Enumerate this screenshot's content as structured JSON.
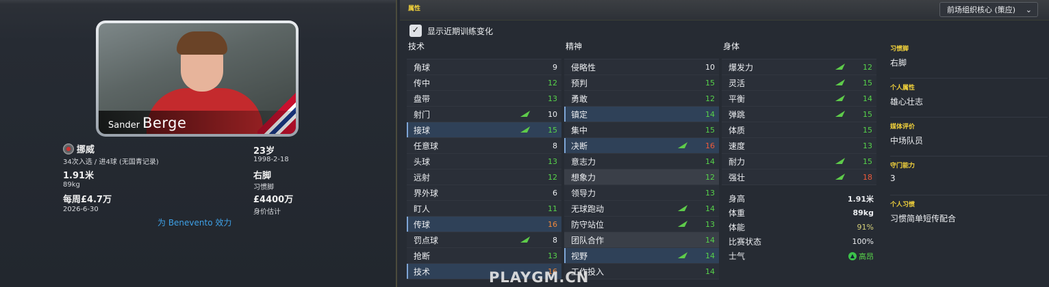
{
  "player": {
    "first_name": "Sander",
    "last_name": "Berge",
    "nation": "挪威",
    "caps": "34次入选 / 进4球 (无国青记录)",
    "age": "23岁",
    "dob": "1998-2-18",
    "height": "1.91米",
    "weight": "89kg",
    "foot": "右脚",
    "foot_label": "习惯脚",
    "wage": "每周£4.7万",
    "contract_end": "2026-6-30",
    "value": "£4400万",
    "value_label": "身价估计",
    "club_line": "为 Benevento 效力"
  },
  "attributes": {
    "section_title": "属性",
    "role": "前场组织核心 (策应)",
    "show_training_label": "显示近期训练变化",
    "show_training_checked": true,
    "technical": {
      "title": "技术",
      "rows": [
        {
          "name": "角球",
          "value": "9",
          "color": "white",
          "arrow": false,
          "hl": ""
        },
        {
          "name": "传中",
          "value": "12",
          "color": "green",
          "arrow": false,
          "hl": ""
        },
        {
          "name": "盘带",
          "value": "13",
          "color": "green",
          "arrow": false,
          "hl": ""
        },
        {
          "name": "射门",
          "value": "10",
          "color": "white",
          "arrow": true,
          "hl": ""
        },
        {
          "name": "接球",
          "value": "15",
          "color": "green",
          "arrow": true,
          "hl": "hl"
        },
        {
          "name": "任意球",
          "value": "8",
          "color": "white",
          "arrow": false,
          "hl": ""
        },
        {
          "name": "头球",
          "value": "13",
          "color": "green",
          "arrow": false,
          "hl": ""
        },
        {
          "name": "远射",
          "value": "12",
          "color": "green",
          "arrow": false,
          "hl": ""
        },
        {
          "name": "界外球",
          "value": "6",
          "color": "white",
          "arrow": false,
          "hl": ""
        },
        {
          "name": "盯人",
          "value": "11",
          "color": "green",
          "arrow": false,
          "hl": ""
        },
        {
          "name": "传球",
          "value": "16",
          "color": "orange",
          "arrow": false,
          "hl": "hl"
        },
        {
          "name": "罚点球",
          "value": "8",
          "color": "white",
          "arrow": true,
          "hl": ""
        },
        {
          "name": "抢断",
          "value": "13",
          "color": "green",
          "arrow": false,
          "hl": ""
        },
        {
          "name": "技术",
          "value": "16",
          "color": "orange",
          "arrow": false,
          "hl": "hl"
        }
      ]
    },
    "mental": {
      "title": "精神",
      "rows": [
        {
          "name": "侵略性",
          "value": "10",
          "color": "white",
          "arrow": false,
          "hl": ""
        },
        {
          "name": "预判",
          "value": "15",
          "color": "green",
          "arrow": false,
          "hl": ""
        },
        {
          "name": "勇敢",
          "value": "12",
          "color": "green",
          "arrow": false,
          "hl": ""
        },
        {
          "name": "镇定",
          "value": "14",
          "color": "green",
          "arrow": false,
          "hl": "hl"
        },
        {
          "name": "集中",
          "value": "15",
          "color": "green",
          "arrow": false,
          "hl": ""
        },
        {
          "name": "决断",
          "value": "16",
          "color": "red",
          "arrow": true,
          "hl": "hl"
        },
        {
          "name": "意志力",
          "value": "14",
          "color": "green",
          "arrow": false,
          "hl": ""
        },
        {
          "name": "想象力",
          "value": "12",
          "color": "green",
          "arrow": false,
          "hl": "hl2"
        },
        {
          "name": "领导力",
          "value": "13",
          "color": "green",
          "arrow": false,
          "hl": ""
        },
        {
          "name": "无球跑动",
          "value": "14",
          "color": "green",
          "arrow": true,
          "hl": ""
        },
        {
          "name": "防守站位",
          "value": "13",
          "color": "green",
          "arrow": true,
          "hl": ""
        },
        {
          "name": "团队合作",
          "value": "14",
          "color": "green",
          "arrow": false,
          "hl": "hl2"
        },
        {
          "name": "视野",
          "value": "14",
          "color": "green",
          "arrow": true,
          "hl": "hl"
        },
        {
          "name": "工作投入",
          "value": "14",
          "color": "green",
          "arrow": false,
          "hl": ""
        }
      ]
    },
    "physical": {
      "title": "身体",
      "rows": [
        {
          "name": "爆发力",
          "value": "12",
          "color": "green",
          "arrow": true,
          "hl": ""
        },
        {
          "name": "灵活",
          "value": "15",
          "color": "green",
          "arrow": true,
          "hl": ""
        },
        {
          "name": "平衡",
          "value": "14",
          "color": "green",
          "arrow": true,
          "hl": ""
        },
        {
          "name": "弹跳",
          "value": "15",
          "color": "green",
          "arrow": true,
          "hl": ""
        },
        {
          "name": "体质",
          "value": "15",
          "color": "green",
          "arrow": false,
          "hl": ""
        },
        {
          "name": "速度",
          "value": "13",
          "color": "green",
          "arrow": false,
          "hl": ""
        },
        {
          "name": "耐力",
          "value": "15",
          "color": "green",
          "arrow": true,
          "hl": ""
        },
        {
          "name": "强壮",
          "value": "18",
          "color": "red",
          "arrow": true,
          "hl": ""
        }
      ]
    },
    "condition": {
      "height_label": "身高",
      "height": "1.91米",
      "weight_label": "体重",
      "weight": "89kg",
      "fitness_label": "体能",
      "fitness": "91%",
      "match_label": "比赛状态",
      "match": "100%",
      "morale_label": "士气",
      "morale": "高昂"
    },
    "side": {
      "foot_title": "习惯脚",
      "foot": "右脚",
      "personality_title": "个人属性",
      "personality": "雄心壮志",
      "media_title": "媒体评价",
      "media": "中场队员",
      "gk_title": "守门能力",
      "gk": "3",
      "pph_title": "个人习惯",
      "pph": "习惯简单短传配合"
    }
  },
  "watermark": "PLAYGM.CN",
  "colors": {
    "accent_yellow": "#f2d23b",
    "green": "#57d34a",
    "orange": "#f0883a",
    "red": "#ef5a3a",
    "link": "#3ea0e6"
  }
}
